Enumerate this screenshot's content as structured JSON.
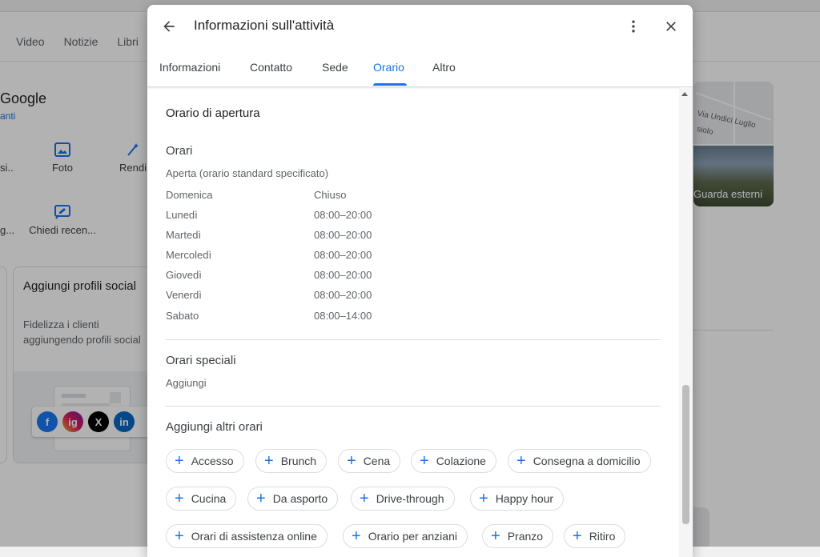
{
  "background": {
    "tabs": [
      "Video",
      "Notizie",
      "Libri"
    ],
    "brand": "Google",
    "link": "anti",
    "actions": [
      {
        "label": "si...",
        "icon": "edit-icon"
      },
      {
        "label": "Foto",
        "icon": "image-icon"
      },
      {
        "label": "Rendi",
        "icon": "wand-icon"
      },
      {
        "label": "g...",
        "icon": "none"
      },
      {
        "label": "Chiedi recen...",
        "icon": "review-icon"
      }
    ],
    "card": {
      "title": "Aggiungi profili social",
      "description": "Fidelizza i clienti aggiungendo profili social"
    },
    "social_icons": [
      "f",
      "ig",
      "X",
      "in"
    ],
    "map_label": "Via Undici Luglio",
    "map_label2": "siolo",
    "photo_label": "Guarda esterni"
  },
  "dialog": {
    "title": "Informazioni sull'attività",
    "tabs": [
      {
        "label": "Informazioni",
        "active": false
      },
      {
        "label": "Contatto",
        "active": false
      },
      {
        "label": "Sede",
        "active": false
      },
      {
        "label": "Orario",
        "active": true
      },
      {
        "label": "Altro",
        "active": false
      }
    ],
    "opening": {
      "heading": "Orario di apertura",
      "hours_title": "Orari",
      "hours_status": "Aperta (orario standard specificato)",
      "days": [
        {
          "day": "Domenica",
          "time": "Chiuso"
        },
        {
          "day": "Lunedì",
          "time": "08:00–20:00"
        },
        {
          "day": "Martedì",
          "time": "08:00–20:00"
        },
        {
          "day": "Mercoledì",
          "time": "08:00–20:00"
        },
        {
          "day": "Giovedì",
          "time": "08:00–20:00"
        },
        {
          "day": "Venerdì",
          "time": "08:00–20:00"
        },
        {
          "day": "Sabato",
          "time": "08:00–14:00"
        }
      ]
    },
    "special": {
      "title": "Orari speciali",
      "add_label": "Aggiungi"
    },
    "more_hours": {
      "title": "Aggiungi altri orari",
      "chips": [
        "Accesso",
        "Brunch",
        "Cena",
        "Colazione",
        "Consegna a domicilio",
        "Cucina",
        "Da asporto",
        "Drive-through",
        "Happy hour",
        "Orari di assistenza online",
        "Orario per anziani",
        "Pranzo",
        "Ritiro"
      ]
    }
  },
  "colors": {
    "accent": "#1a73e8",
    "text": "#202124",
    "muted": "#5f6368"
  }
}
